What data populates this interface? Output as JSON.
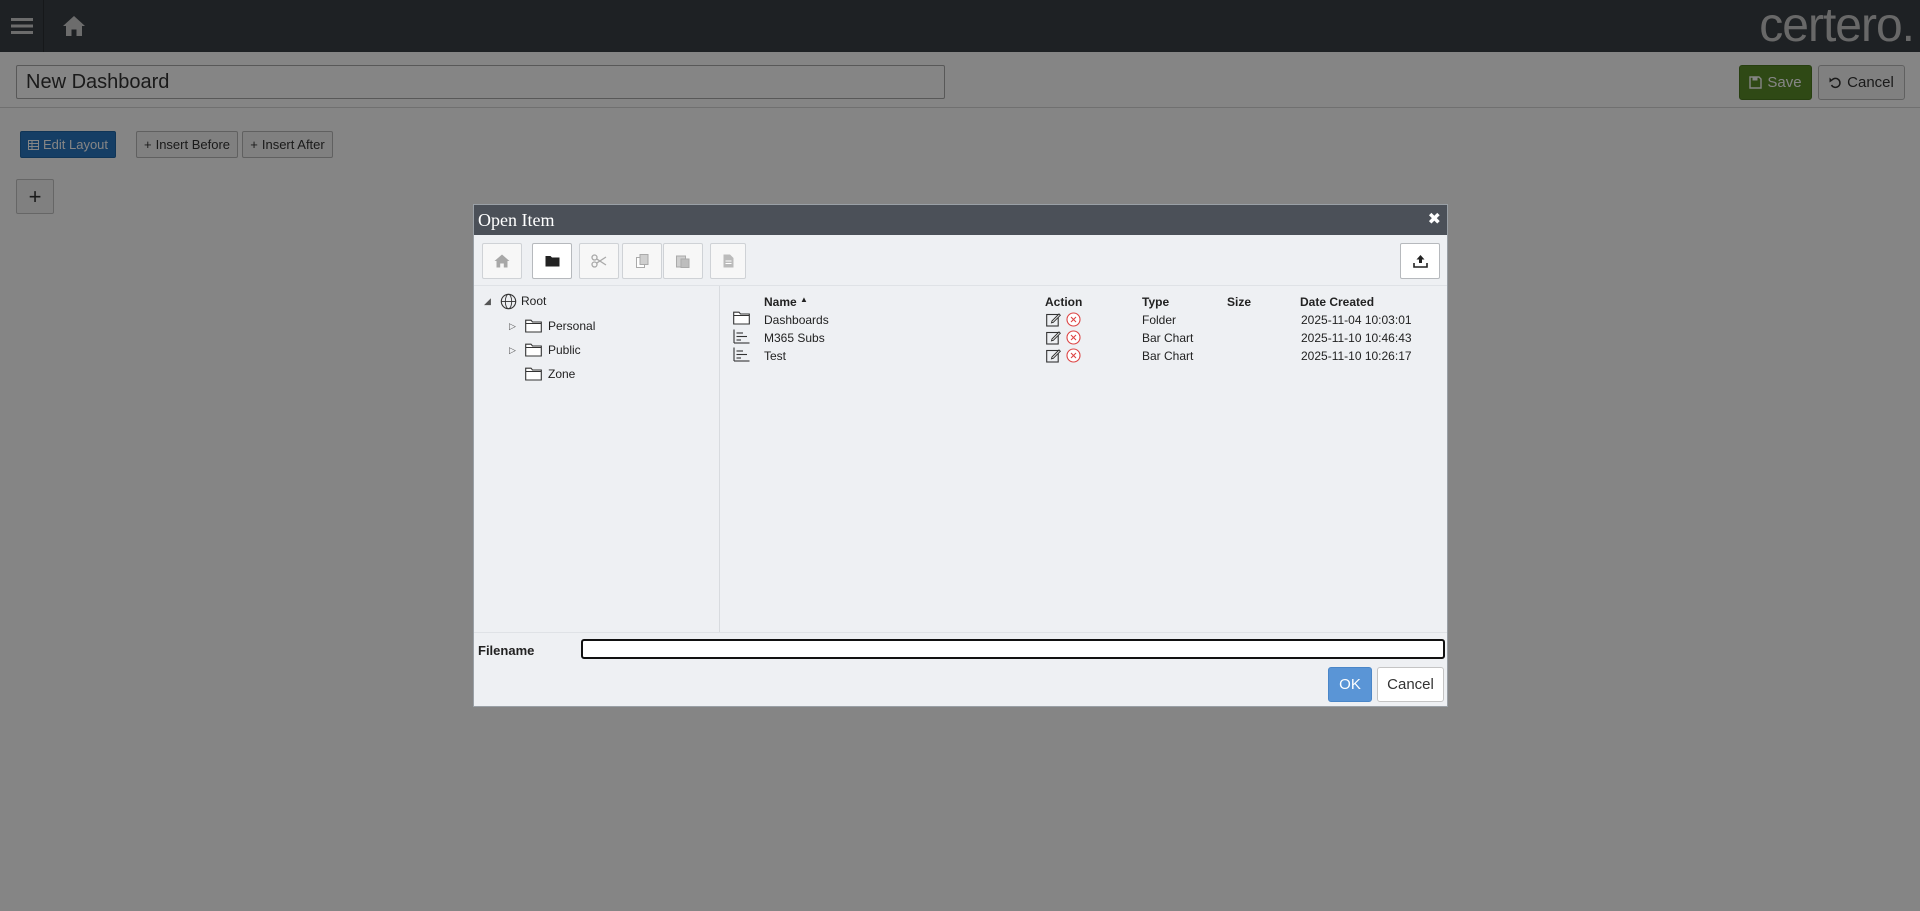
{
  "brand": {
    "logo_text": "certero."
  },
  "header": {
    "title_value": "New Dashboard",
    "save_label": "Save",
    "cancel_label": "Cancel"
  },
  "toolbar": {
    "edit_layout_label": "Edit Layout",
    "insert_before_label": "Insert Before",
    "insert_after_label": "Insert After",
    "add_label": "+"
  },
  "dialog": {
    "title": "Open Item",
    "close_glyph": "✖",
    "tree": {
      "root": "Root",
      "children": [
        {
          "label": "Personal"
        },
        {
          "label": "Public"
        },
        {
          "label": "Zone"
        }
      ]
    },
    "columns": {
      "name": "Name",
      "action": "Action",
      "type": "Type",
      "size": "Size",
      "date_created": "Date Created"
    },
    "rows": [
      {
        "name": "Dashboards",
        "type": "Folder",
        "size": "",
        "date": "2025-11-04 10:03:01"
      },
      {
        "name": "M365 Subs",
        "type": "Bar Chart",
        "size": "",
        "date": "2025-11-10 10:46:43"
      },
      {
        "name": "Test",
        "type": "Bar Chart",
        "size": "",
        "date": "2025-11-10 10:26:17"
      }
    ],
    "filename_label": "Filename",
    "filename_value": "",
    "ok_label": "OK",
    "cancel_label": "Cancel"
  },
  "colors": {
    "topbar": "#3b4046",
    "save": "#5b8c2a",
    "edit_layout": "#2a78c2",
    "ok": "#5a95d6",
    "dialog_header": "#4b5058"
  }
}
